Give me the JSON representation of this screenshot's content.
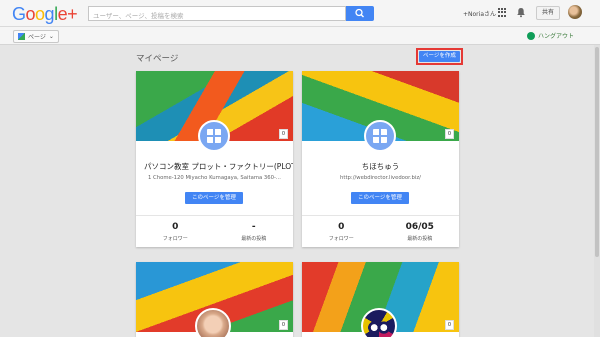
{
  "header": {
    "logo": "Google+",
    "search_placeholder": "ユーザー、ページ、投稿を検索",
    "user_name": "+Noriaさん",
    "share_label": "共有"
  },
  "subbar": {
    "page_switch_label": "ページ",
    "hangout_label": "ハングアウト"
  },
  "main": {
    "section_title": "マイページ",
    "create_page_label": "ページを作成"
  },
  "cards": [
    {
      "title": "パソコン教室 プロット・ファクトリー(PLOT-F...",
      "subtitle": "1 Chome-120 Miyacho Kumagaya, Saitama 360-...",
      "badge": "0",
      "manage_label": "このページを管理",
      "stat1_value": "0",
      "stat1_label": "フォロワー",
      "stat2_value": "-",
      "stat2_label": "最新の投稿"
    },
    {
      "title": "ちほちゅう",
      "subtitle": "http://webdirector.livedoor.biz/",
      "badge": "0",
      "manage_label": "このページを管理",
      "stat1_value": "0",
      "stat1_label": "フォロワー",
      "stat2_value": "06/05",
      "stat2_label": "最新の投稿"
    },
    {
      "badge": "0"
    },
    {
      "badge": "0"
    }
  ],
  "colors": {
    "accent": "#4285f4",
    "highlight": "#e53935",
    "background": "#e5e5e5"
  }
}
